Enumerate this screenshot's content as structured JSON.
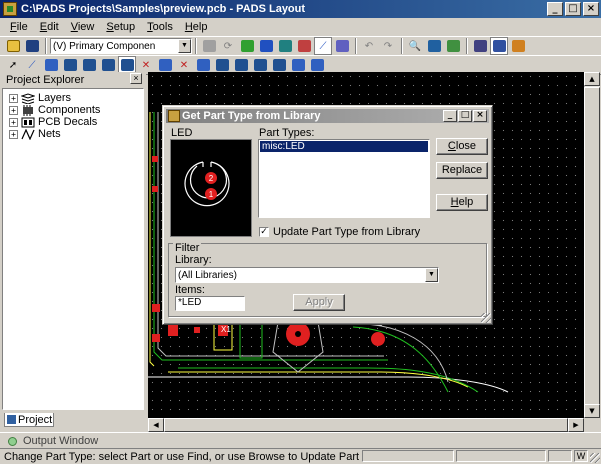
{
  "window": {
    "title": "C:\\PADS Projects\\Samples\\preview.pcb - PADS Layout"
  },
  "menu": [
    {
      "label": "File",
      "key": "F"
    },
    {
      "label": "Edit",
      "key": "E"
    },
    {
      "label": "View",
      "key": "V"
    },
    {
      "label": "Setup",
      "key": "S"
    },
    {
      "label": "Tools",
      "key": "T"
    },
    {
      "label": "Help",
      "key": "H"
    }
  ],
  "toolbar": {
    "layer_select": "(V) Primary Componen"
  },
  "explorer": {
    "title": "Project Explorer",
    "items": [
      "Layers",
      "Components",
      "PCB Decals",
      "Nets"
    ],
    "tab": "Project"
  },
  "output": {
    "label": "Output Window"
  },
  "status": {
    "text": "Change Part Type: select Part or use Find, or use Browse to Update Part",
    "indicator": "W"
  },
  "dialog": {
    "title": "Get Part Type from Library",
    "preview_label": "LED",
    "part_types_label": "Part Types:",
    "part_types": [
      "misc:LED"
    ],
    "buttons": {
      "close": "Close",
      "replace": "Replace",
      "help": "Help",
      "apply": "Apply"
    },
    "update_checkbox": "Update Part Type from Library",
    "update_checked": true,
    "filter": {
      "group_label": "Filter",
      "library_label": "Library:",
      "library_value": "(All Libraries)",
      "items_label": "Items:",
      "items_value": "*LED"
    },
    "preview_pins": [
      "2",
      "1"
    ]
  },
  "canvas": {
    "ref_label": "X1",
    "colors": {
      "pad": "#e02020",
      "outline": "#ffff40",
      "trace": "#20c020",
      "background": "#000000"
    }
  }
}
